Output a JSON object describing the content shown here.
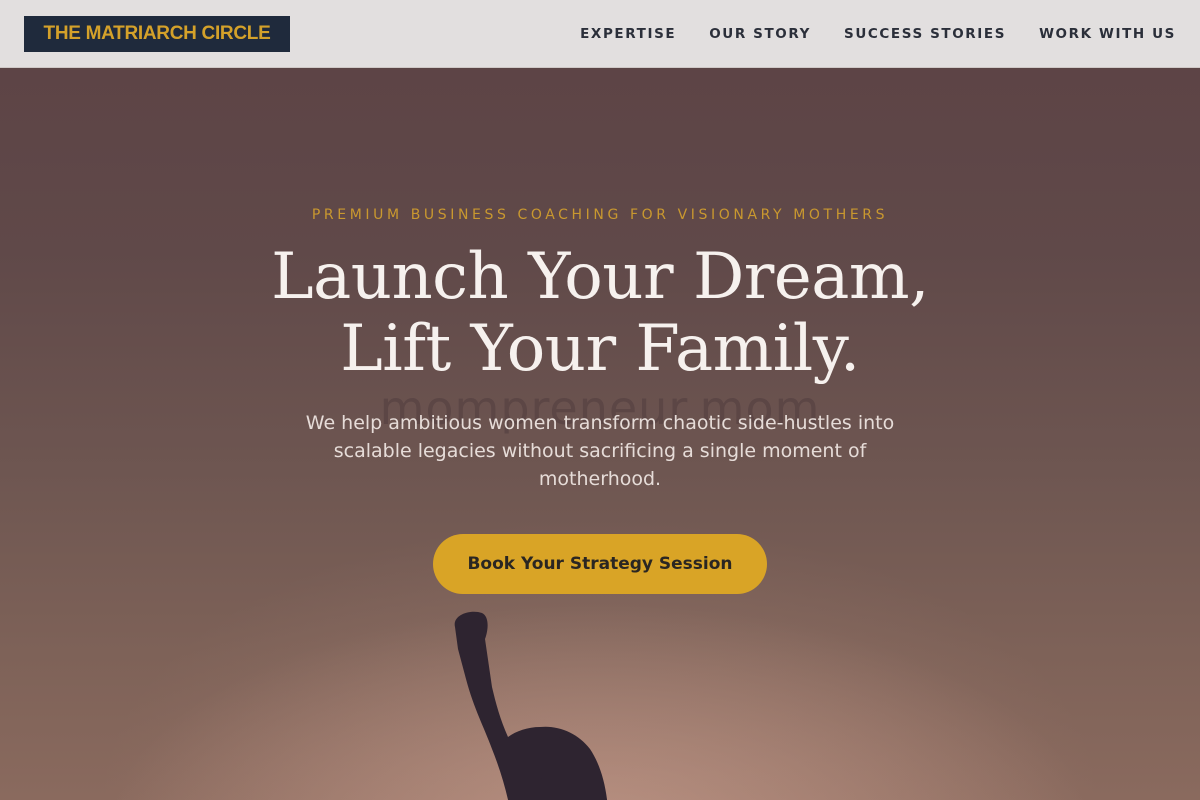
{
  "header": {
    "logo_text": "THE MATRIARCH CIRCLE",
    "nav": [
      "EXPERTISE",
      "OUR STORY",
      "SUCCESS STORIES",
      "WORK WITH US"
    ]
  },
  "hero": {
    "eyebrow": "PREMIUM BUSINESS COACHING FOR VISIONARY MOTHERS",
    "headline_line1": "Launch Your Dream,",
    "headline_line2": "Lift Your Family.",
    "watermark": "mompreneur.mom",
    "subhead": "We help ambitious women transform chaotic side-hustles into scalable legacies without sacrificing a single moment of motherhood.",
    "cta_label": "Book Your Strategy Session",
    "image": "silhouette-raised-fist"
  },
  "colors": {
    "accent_gold": "#d9a426",
    "logo_bg": "#1f2a3c",
    "header_bg": "#e2dfdf",
    "hero_bg": "#5d4446"
  }
}
